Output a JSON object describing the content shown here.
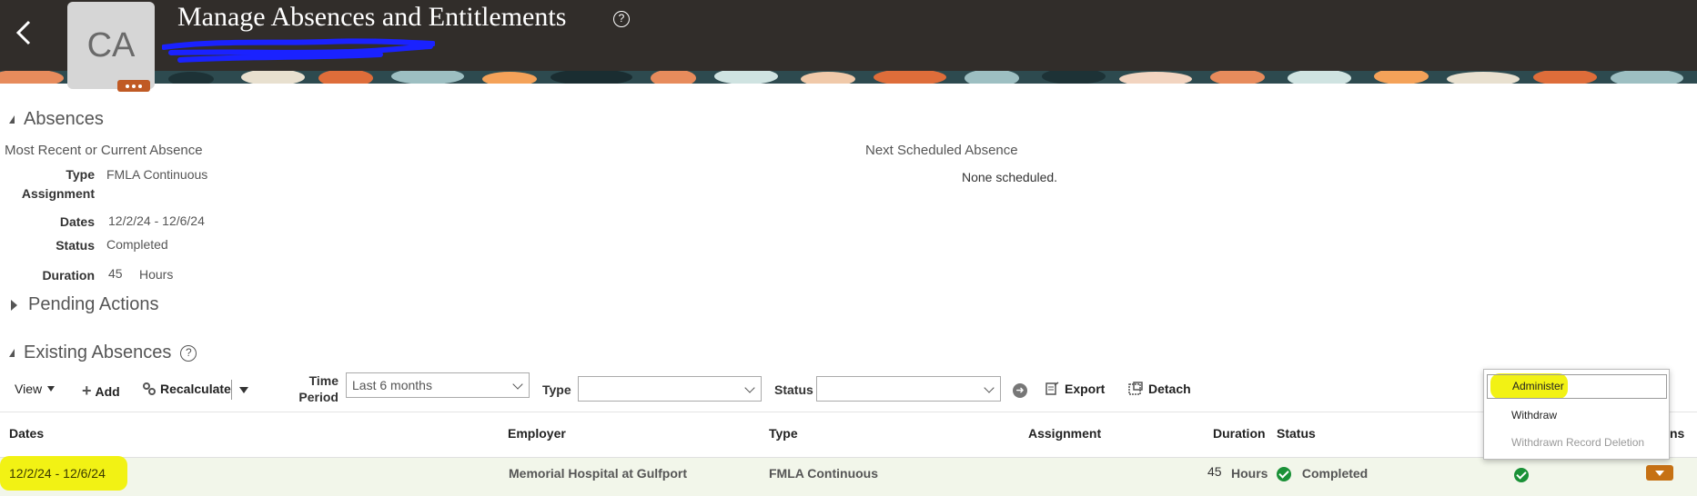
{
  "header": {
    "title": "Manage Absences and Entitlements",
    "avatar_initials": "CA",
    "brand_colors": {
      "header_bg": "#312d2a",
      "accent": "#c05a24"
    }
  },
  "absences": {
    "section_title": "Absences",
    "recent": {
      "heading": "Most Recent or Current Absence",
      "type_label": "Type",
      "type_value": "FMLA Continuous",
      "assignment_label": "Assignment",
      "dates_label": "Dates",
      "dates_start": "12/2/24",
      "dates_sep": "-",
      "dates_end": "12/6/24",
      "status_label": "Status",
      "status_value": "Completed",
      "duration_label": "Duration",
      "duration_value": "45",
      "duration_unit": "Hours"
    },
    "next": {
      "heading": "Next Scheduled Absence",
      "value": "None scheduled."
    }
  },
  "pending": {
    "section_title": "Pending Actions"
  },
  "existing": {
    "section_title": "Existing Absences",
    "toolbar": {
      "view": "View",
      "add": "Add",
      "recalculate": "Recalculate",
      "time_period_label_1": "Time",
      "time_period_label_2": "Period",
      "time_period_value": "Last 6 months",
      "type_label": "Type",
      "type_value": "",
      "status_label": "Status",
      "status_value": "",
      "export": "Export",
      "detach": "Detach"
    },
    "columns": {
      "dates": "Dates",
      "employer": "Employer",
      "type": "Type",
      "assignment": "Assignment",
      "duration": "Duration",
      "status": "Status",
      "actions_tail": "ns"
    },
    "rows": [
      {
        "dates": "12/2/24 - 12/6/24",
        "employer": "Memorial Hospital at Gulfport",
        "type": "FMLA Continuous",
        "assignment": "",
        "duration": "45",
        "duration_unit": "Hours",
        "status": "Completed"
      }
    ],
    "actions_menu": {
      "items": [
        "Administer",
        "Withdraw",
        "Withdrawn Record Deletion"
      ]
    }
  }
}
